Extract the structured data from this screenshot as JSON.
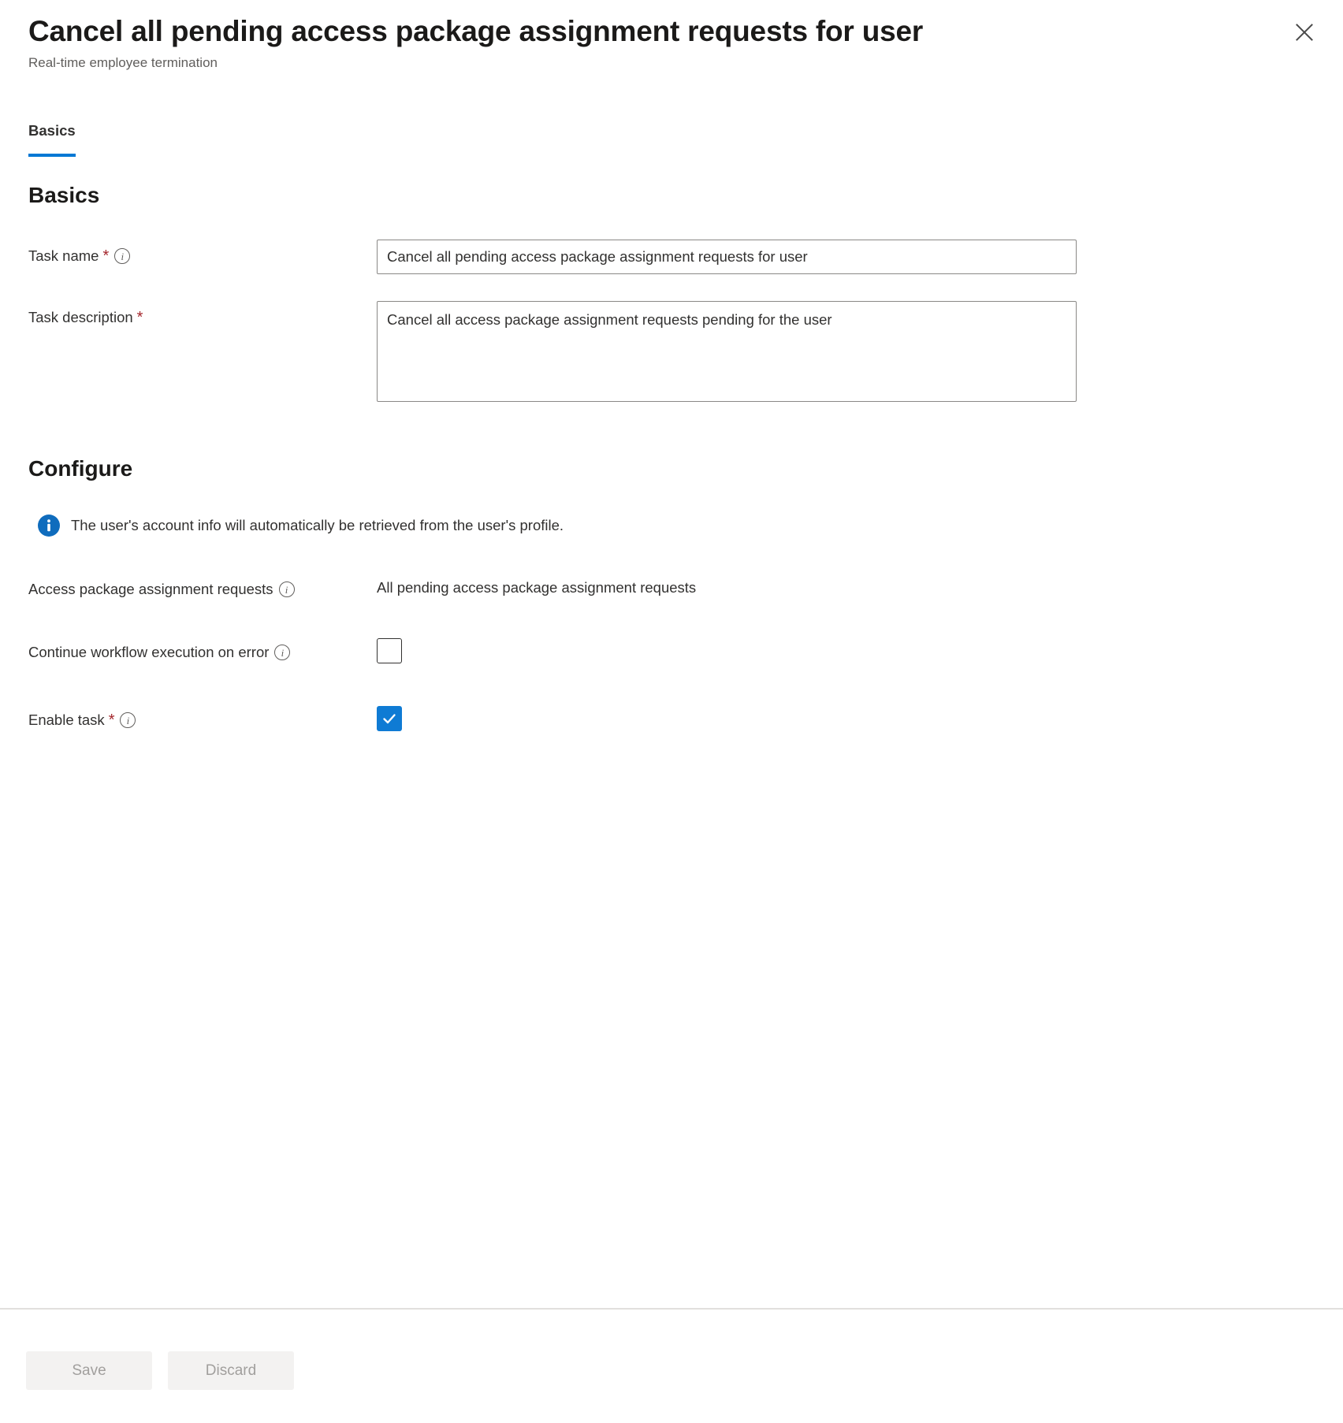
{
  "panel": {
    "title": "Cancel all pending access package assignment requests for user",
    "subtitle": "Real-time employee termination",
    "close_label": "Close"
  },
  "tabs": [
    {
      "label": "Basics",
      "active": true
    }
  ],
  "sections": {
    "basics": {
      "heading": "Basics",
      "task_name": {
        "label": "Task name",
        "required": true,
        "required_marker": "*",
        "value": "Cancel all pending access package assignment requests for user",
        "placeholder": ""
      },
      "task_description": {
        "label": "Task description",
        "required": true,
        "required_marker": "*",
        "value": "Cancel all access package assignment requests pending for the user",
        "placeholder": ""
      }
    },
    "configure": {
      "heading": "Configure",
      "info_message": "The user's account info will automatically be retrieved from the user's profile.",
      "access_package_requests": {
        "label": "Access package assignment requests",
        "value": "All pending access package assignment requests"
      },
      "continue_on_error": {
        "label": "Continue workflow execution on error",
        "checked": false
      },
      "enable_task": {
        "label": "Enable task",
        "required": true,
        "required_marker": "*",
        "checked": true
      }
    }
  },
  "footer": {
    "save_label": "Save",
    "discard_label": "Discard"
  },
  "colors": {
    "accent": "#0078d4",
    "info_badge": "#0f6cbd",
    "checkbox_checked": "#0f7bd4",
    "required_asterisk": "#a4262c",
    "subtitle_text": "#605e5c",
    "disabled_button_bg": "#f3f2f1",
    "disabled_button_text": "#a19f9d"
  },
  "icons": {
    "close": "close-icon",
    "info_filled": "info-filled-icon",
    "info_outline": "info-outline-icon",
    "check": "check-icon"
  }
}
